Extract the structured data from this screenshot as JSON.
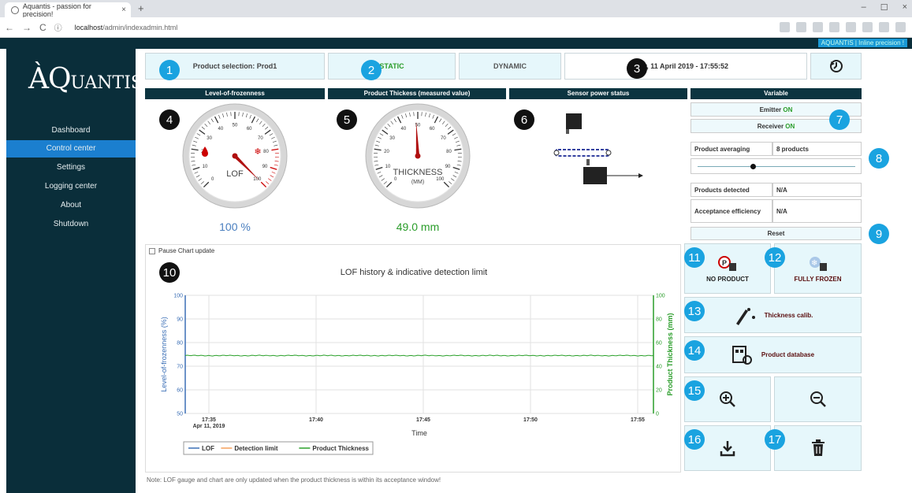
{
  "browser": {
    "tab_title": "Aquantis - passion for precision!",
    "url_host": "localhost",
    "url_path": "/admin/indexadmin.html",
    "new_tab": "+",
    "tab_close": "×",
    "back": "←",
    "forward": "→",
    "reload": "C",
    "info": "ⓘ",
    "minimize": "–",
    "maximize": "☐",
    "close": "×"
  },
  "topbar": {
    "brand_line": "AQUANTIS | Inline precision !"
  },
  "sidebar": {
    "logo_a": "ÀQ",
    "logo_b": "UANTIS",
    "items": [
      "Dashboard",
      "Control center",
      "Settings",
      "Logging center",
      "About",
      "Shutdown"
    ],
    "active": "Control center"
  },
  "controls": {
    "product_selection": "Product selection: Prod1",
    "static": "STATIC",
    "dynamic": "DYNAMIC",
    "datetime": "y, 11 April 2019 - 17:55:52"
  },
  "headers": {
    "lof": "Level-of-frozenness",
    "thickness": "Product Thickess (measured value)",
    "sensor": "Sensor power status",
    "variable": "Variable"
  },
  "gauges": {
    "lof": {
      "label": "LOF",
      "value": 100,
      "display": "100 %",
      "ticks": [
        "0",
        "10",
        "20",
        "30",
        "40",
        "50",
        "60",
        "70",
        "80",
        "90",
        "100"
      ]
    },
    "thickness": {
      "label": "THICKNESS",
      "unit": "(MM)",
      "value": 49,
      "display": "49.0 mm",
      "ticks": [
        "0",
        "10",
        "20",
        "30",
        "40",
        "50",
        "60",
        "70",
        "80",
        "90",
        "100"
      ]
    }
  },
  "variable": {
    "emitter_label": "Emitter",
    "emitter_state": "ON",
    "receiver_label": "Receiver",
    "receiver_state": "ON",
    "product_averaging_label": "Product averaging",
    "product_averaging_value": "8 products",
    "slider_fraction": 0.35,
    "products_detected_label": "Products detected",
    "products_detected_value": "N/A",
    "acceptance_label": "Acceptance efficiency",
    "acceptance_value": "N/A",
    "reset": "Reset"
  },
  "tiles": {
    "no_product": "NO PRODUCT",
    "fully_frozen": "FULLY FROZEN",
    "thickness_calib": "Thickness calib.",
    "product_database": "Product database"
  },
  "chart_panel": {
    "pause_label": "Pause Chart update"
  },
  "chart_data": {
    "type": "line",
    "title": "LOF history & indicative detection limit",
    "xlabel": "Time",
    "ylabel_left": "Level-of-frozenness (%)",
    "ylabel_right": "Product Thickness (mm)",
    "ylim_left": [
      50,
      100
    ],
    "ylim_right": [
      0,
      100
    ],
    "x_ticks": [
      "17:35",
      "17:40",
      "17:45",
      "17:50",
      "17:55"
    ],
    "x_date": "Apr 11, 2019",
    "y_left_ticks": [
      "50",
      "60",
      "70",
      "80",
      "90",
      "100"
    ],
    "y_right_ticks": [
      "0",
      "20",
      "40",
      "60",
      "80",
      "100"
    ],
    "legend_position": "bottom-left",
    "grid": true,
    "series": [
      {
        "name": "LOF",
        "color": "#3b6fb6",
        "values": []
      },
      {
        "name": "Detection limit",
        "color": "#f5a15a",
        "values": []
      },
      {
        "name": "Product Thickness",
        "color": "#2aa02a",
        "axis": "right",
        "value": 49
      }
    ]
  },
  "note": "Note: LOF gauge and chart are only updated when the product thickness is within its acceptance window!",
  "badges": [
    "1",
    "2",
    "3",
    "4",
    "5",
    "6",
    "7",
    "8",
    "9",
    "10",
    "11",
    "12",
    "13",
    "14",
    "15",
    "16",
    "17"
  ],
  "icons": {
    "zoom_in": "zoom-in-icon",
    "zoom_out": "zoom-out-icon",
    "download": "download-icon",
    "trash": "trash-icon",
    "sync": "sync-icon"
  }
}
